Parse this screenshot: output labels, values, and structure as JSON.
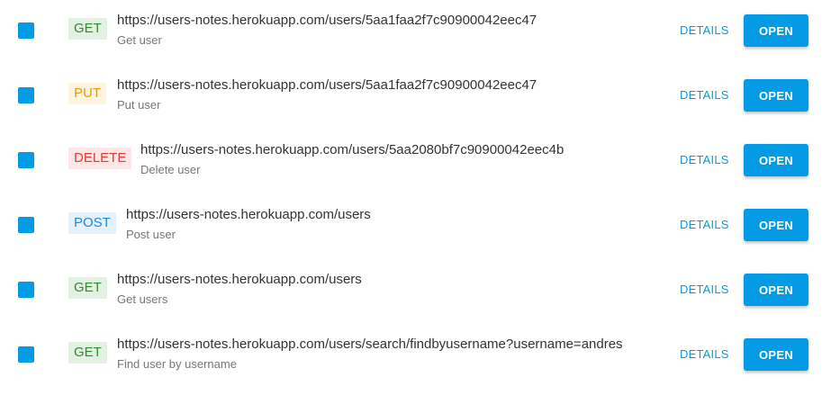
{
  "colors": {
    "accent": "#039be5",
    "get": "#2e8b2e",
    "put": "#ef9a00",
    "delete": "#e53935",
    "post": "#1e88e5"
  },
  "requests": [
    {
      "method": "GET",
      "url": "https://users-notes.herokuapp.com/users/5aa1faa2f7c90900042eec47",
      "description": "Get user",
      "details_label": "DETAILS",
      "open_label": "OPEN"
    },
    {
      "method": "PUT",
      "url": "https://users-notes.herokuapp.com/users/5aa1faa2f7c90900042eec47",
      "description": "Put user",
      "details_label": "DETAILS",
      "open_label": "OPEN"
    },
    {
      "method": "DELETE",
      "url": "https://users-notes.herokuapp.com/users/5aa2080bf7c90900042eec4b",
      "description": "Delete user",
      "details_label": "DETAILS",
      "open_label": "OPEN"
    },
    {
      "method": "POST",
      "url": "https://users-notes.herokuapp.com/users",
      "description": "Post user",
      "details_label": "DETAILS",
      "open_label": "OPEN"
    },
    {
      "method": "GET",
      "url": "https://users-notes.herokuapp.com/users",
      "description": "Get users",
      "details_label": "DETAILS",
      "open_label": "OPEN"
    },
    {
      "method": "GET",
      "url": "https://users-notes.herokuapp.com/users/search/findbyusername?username=andres",
      "description": "Find user by username",
      "details_label": "DETAILS",
      "open_label": "OPEN"
    }
  ]
}
